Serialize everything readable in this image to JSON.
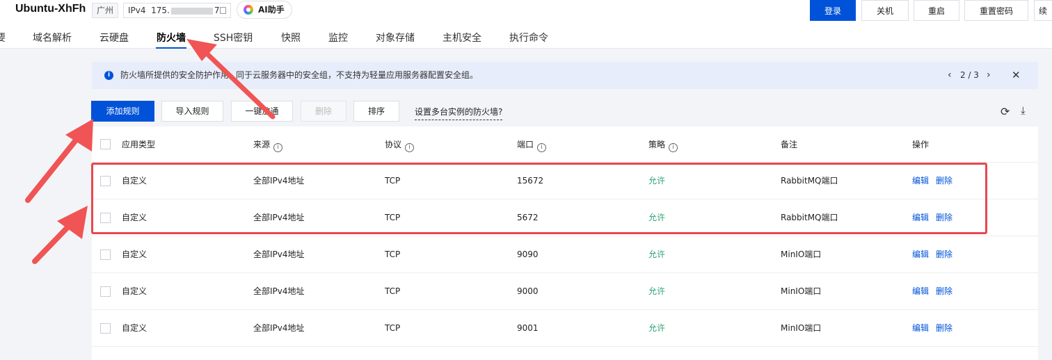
{
  "instance": {
    "name": "Ubuntu-XhFh",
    "region": "广州",
    "ip_label": "IPv4",
    "ip_prefix": "175.",
    "ip_suffix": "7",
    "ai_label": "AI助手"
  },
  "header_buttons": {
    "login": "登录",
    "shutdown": "关机",
    "restart": "重启",
    "reset_password": "重置密码",
    "more": "续"
  },
  "tabs": [
    {
      "label": "要"
    },
    {
      "label": "域名解析"
    },
    {
      "label": "云硬盘"
    },
    {
      "label": "防火墙",
      "active": true
    },
    {
      "label": "SSH密钥"
    },
    {
      "label": "快照"
    },
    {
      "label": "监控"
    },
    {
      "label": "对象存储"
    },
    {
      "label": "主机安全"
    },
    {
      "label": "执行命令"
    }
  ],
  "notice": {
    "text": "防火墙所提供的安全防护作用",
    "text_tail": "同于云服务器中的安全组，不支持为轻量应用服务器配置安全组。",
    "page": "2 / 3",
    "prev": "‹",
    "next": "›",
    "close": "✕"
  },
  "actions": {
    "add_rule": "添加规则",
    "import_rule": "导入规则",
    "allow_all": "一键放通",
    "delete": "删除",
    "sort": "排序",
    "multi_instance_link": "设置多台实例的防火墙?"
  },
  "table": {
    "columns": [
      "应用类型",
      "来源",
      "协议",
      "端口",
      "策略",
      "备注",
      "操作"
    ],
    "rows": [
      {
        "type": "自定义",
        "source": "全部IPv4地址",
        "protocol": "TCP",
        "port": "15672",
        "policy": "允许",
        "note": "RabbitMQ端口",
        "edit": "编辑",
        "delete": "删除"
      },
      {
        "type": "自定义",
        "source": "全部IPv4地址",
        "protocol": "TCP",
        "port": "5672",
        "policy": "允许",
        "note": "RabbitMQ端口",
        "edit": "编辑",
        "delete": "删除"
      },
      {
        "type": "自定义",
        "source": "全部IPv4地址",
        "protocol": "TCP",
        "port": "9090",
        "policy": "允许",
        "note": "MinIO端口",
        "edit": "编辑",
        "delete": "删除"
      },
      {
        "type": "自定义",
        "source": "全部IPv4地址",
        "protocol": "TCP",
        "port": "9000",
        "policy": "允许",
        "note": "MinIO端口",
        "edit": "编辑",
        "delete": "删除"
      },
      {
        "type": "自定义",
        "source": "全部IPv4地址",
        "protocol": "TCP",
        "port": "9001",
        "policy": "允许",
        "note": "MinIO端口",
        "edit": "编辑",
        "delete": "删除"
      }
    ]
  },
  "colors": {
    "primary": "#0052d9",
    "allow": "#2ba471",
    "annotation": "#e8474e",
    "notice_bg": "#e8edfb"
  },
  "icons": {
    "info": "info-icon",
    "refresh": "refresh-icon",
    "download": "download-icon",
    "copy": "copy-icon",
    "help": "help-icon"
  }
}
